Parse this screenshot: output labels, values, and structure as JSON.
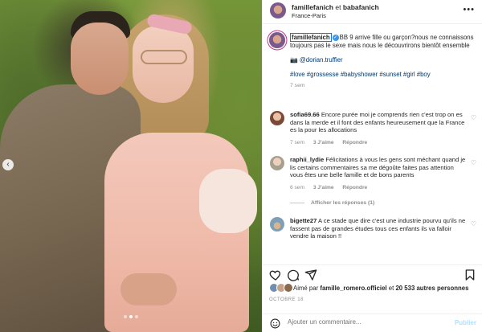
{
  "post": {
    "header": {
      "user1": "famillefanich",
      "and": "et",
      "user2": "babafanich",
      "location": "France-Paris",
      "more_icon": "more-horizontal-icon"
    },
    "caption": {
      "user": "famillefanich",
      "text_line1": "BB 9 arrive fille ou garçon?nous ne connaissons toujours pas le sexe mais nous le découvrirons bientôt ensemble",
      "photo_credit": "📷 @dorian.truffier",
      "hashtags": "#love #grossesse #babyshower #sunset #girl #boy",
      "time": "7 sem"
    },
    "comments": [
      {
        "user": "sofia69.66",
        "text": "Encore purée moi je comprends rien c'est trop on es dans la merde et il font des enfants heureusement que la France es la pour les allocations",
        "time": "7 sem",
        "likes": "3 J'aime",
        "reply": "Répondre"
      },
      {
        "user": "raphii_lydie",
        "text": "Félicitations à vous les gens sont méchant quand je lis certains commentaires sa me dégoûte faites pas attention vous êtes une belle famille et de bons parents",
        "time": "6 sem",
        "likes": "3 J'aime",
        "reply": "Répondre",
        "view_replies": "Afficher les réponses (1)"
      },
      {
        "user": "bigette27",
        "text": "A ce stade que dire c'est une industrie pourvu qu'ils ne fassent pas de grandes études tous ces enfants ils va falloir vendre la maison !!",
        "time": "",
        "likes": "",
        "reply": ""
      }
    ],
    "likes": {
      "prefix": "Aimé par",
      "user": "famille_romero.officiel",
      "and": "et",
      "count": "20 533 autres personnes"
    },
    "date": "OCTOBRE 18",
    "add_comment": {
      "placeholder": "Ajouter un commentaire...",
      "publish": "Publier"
    }
  },
  "colors": {
    "text": "#262626",
    "muted": "#8e8e8e",
    "link": "#00376b",
    "verified": "#3897f0",
    "publish_disabled": "#b2dffc"
  }
}
